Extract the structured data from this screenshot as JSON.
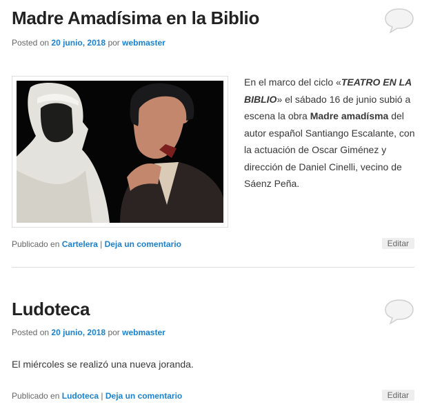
{
  "posts": [
    {
      "title": "Madre Amadísima en la Biblio",
      "posted_on": "Posted on",
      "date": "20 junio, 2018",
      "by": "por",
      "author": "webmaster",
      "body": {
        "p1": "En el marco del ciclo «",
        "cycle": "TEATRO EN LA BIBLIO",
        "p2": "» el sábado 16 de junio subió a escena la obra ",
        "play": "Madre amadísma",
        "p3": " del autor español Santiango Escalante, con la actuación de Oscar Giménez y dirección de Daniel Cinelli, vecino de Sáenz Peña."
      },
      "published_in": "Publicado en",
      "category": "Cartelera",
      "separator": "|",
      "comment_link": "Deja un comentario",
      "edit": "Editar"
    },
    {
      "title": "Ludoteca",
      "posted_on": "Posted on",
      "date": "20 junio, 2018",
      "by": "por",
      "author": "webmaster",
      "body_text": "El miércoles se realizó una nueva joranda.",
      "published_in": "Publicado en",
      "category": "Ludoteca",
      "separator": "|",
      "comment_link": "Deja un comentario",
      "edit": "Editar"
    }
  ],
  "colors": {
    "link": "#1982d1",
    "title": "#222222",
    "meta": "#666666",
    "edit_bg": "#eeeeee"
  },
  "icons": {
    "comments": "comment-bubble-icon"
  }
}
